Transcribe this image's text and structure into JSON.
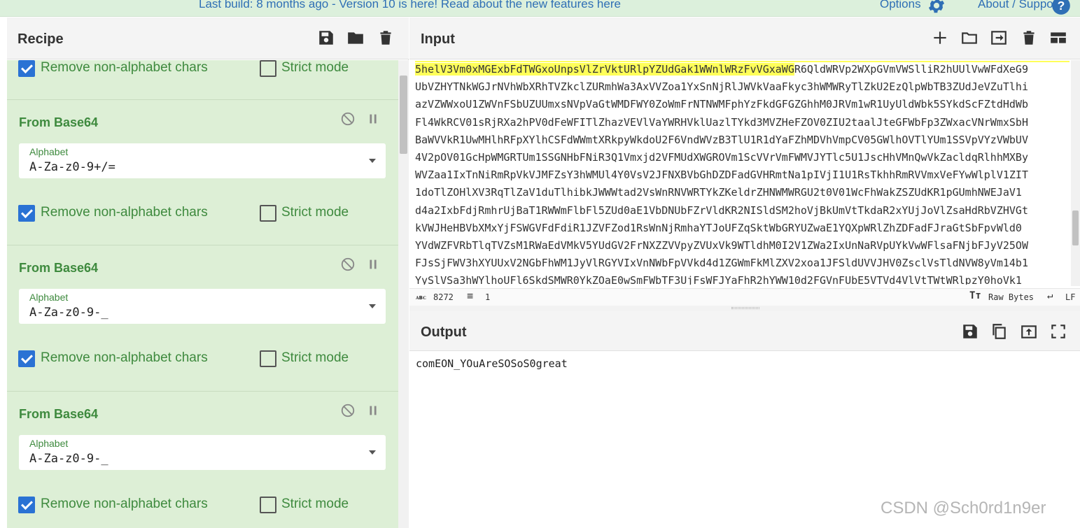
{
  "banner": {
    "message": "Last build: 8 months ago - Version 10 is here! Read about the new features ",
    "link_text": "here",
    "options_label": "Options",
    "about_label": "About / Support"
  },
  "recipe": {
    "title": "Recipe",
    "top_row": {
      "remove_label": "Remove non-alphabet chars",
      "remove_checked": true,
      "strict_label": "Strict mode",
      "strict_checked": false
    },
    "operations": [
      {
        "title": "From Base64",
        "alphabet_label": "Alphabet",
        "alphabet_value": "A-Za-z0-9+/=",
        "remove_label": "Remove non-alphabet chars",
        "remove_checked": true,
        "strict_label": "Strict mode",
        "strict_checked": false
      },
      {
        "title": "From Base64",
        "alphabet_label": "Alphabet",
        "alphabet_value": "A-Za-z0-9-_",
        "remove_label": "Remove non-alphabet chars",
        "remove_checked": true,
        "strict_label": "Strict mode",
        "strict_checked": false
      },
      {
        "title": "From Base64",
        "alphabet_label": "Alphabet",
        "alphabet_value": "A-Za-z0-9-_",
        "remove_label": "Remove non-alphabet chars",
        "remove_checked": true,
        "strict_label": "Strict mode",
        "strict_checked": false
      }
    ]
  },
  "input": {
    "title": "Input",
    "highlighted": "5helV3Vm0xMGExbFdTWGxoUnpsVlZrVktURlpYZUdGak1WWnlWRzFvVGxaWG",
    "lines": [
      "R6QldWRVp2WXpGVmVWSlliR2hUUlVwWFdXeG9",
      "UbVZHYTNkWGJrNVhWbXRhTVZkclZURmhWa3AxVVZoa1YxSnNjRlJWVkVaaFkyc3hWMWRyTlZkU2EzQlpWbTB3ZUdJeVZuTlhi",
      "azVZWWxoU1ZWVnFSbUZUUmxsNVpVaGtWMDFWY0ZoWmFrNTNWMFphYzFkdGFGZGhhM0JRVm1wR1UyUldWbk5SYkdScFZtdHdWb",
      "Fl4WkRCV01sRjRXa2hPV0dFeWFITlZhazVEVlVaYWRHVklUazlTYkd3MVZHeFZOV0ZIU2taalJteGFWbFp3ZWxacVNrWmxSbH",
      "BaWVVkR1UwMHlhRFpXYlhCSFdWWmtXRkpyWkdoU2F6VndWVzB3TlU1R1dYaFZhMDVhVmpCV05GWlhOVTlYUm1SSVpVYzVWbUV",
      "4V2pOV01GcHpWMGRTUm1SSGNHbFNiR3Q1Vmxjd2VFMUdXWGROVm1ScVVrVmFWMVJYTlc5U1JscHhVMnQwVkZacldqRlhhMXBy",
      "WVZaa1IxTnNiRmRpVkVJMFZsY3hWMUl4Y0VsV2JFNXBVbGhDZDFadGVHRmtNa1pIVjI1U1RsTkhhRmRVVmxVeFYwWlplV1ZIT",
      "1doTlZOHlXV3RqTlZaV1duTlhibkJWWWtad2VsWnRNVWRTYkZKeldrZHNWMWRGU2t0V01WcFhWakZSZUdKR1pGUmhNWEJaV1",
      "d4a2IxbFdjRmhrUjBaT1RWWmFlbFl5ZUd0aE1VbDNUbFZrVldKR2NISldSM2hoVjBkUmVtTkdaR2xYUjJoVlZsaHdRbVZHVGt",
      "kVWJHeHBVbXMxYjFSWGVFdFdiR1JZVFZod1RsWnNjRmhaYTJoUFZqSktWbGRYUZwaE1YQXpWRlZhZDFadFJraGtSbFpvWld0",
      "YVdWZFVRbTlqTVZsM1RWaEdVMkV5YUdGV2FrNXZZVVpyZVUxVk9WTldhM0I2V1ZWa2IxUnNaRVpUYkVwWFlsaFNjbFJyV25OW",
      "FJsSjFWV3hXYUUxV2NGbFhWM1JyVlRGYVIxVnNWbFpVVkd4d1ZGWmFkMlZXV2xoa1JFSldUVVJHV0ZsclVsTldNVW8yVm14b1",
      "YySlVSa3hWYlhoUFl6SkdSMWR0YkZOaE0wSmFWbTF3UjFsWFJYaFhR2hYWW10d2FGVnFUbE5VTVd4VlVtTWtWRlpzY0hoVk1"
    ],
    "char_count": "8272",
    "line_count": "1",
    "encoding_label": "Raw Bytes",
    "eol_label": "LF"
  },
  "output": {
    "title": "Output",
    "text": "comEON_YOuAreSOSoS0great"
  },
  "watermark": "CSDN @Sch0rd1n9er"
}
